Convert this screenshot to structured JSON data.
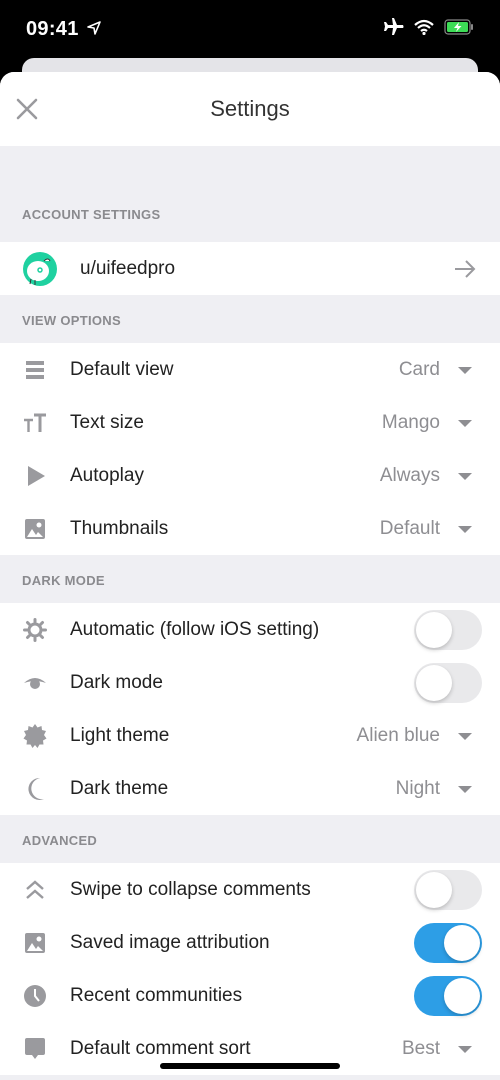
{
  "status_bar": {
    "time": "09:41",
    "icons": [
      "location-arrow-icon",
      "airplane-icon",
      "wifi-icon",
      "battery-charging-icon"
    ]
  },
  "header": {
    "title": "Settings",
    "close_icon": "close-icon"
  },
  "colors": {
    "accent": "#2d9ee6",
    "avatar": "#1fd1a0",
    "background": "#efeff3",
    "secondary_text": "#8e8e92"
  },
  "sections": {
    "account": {
      "heading": "ACCOUNT SETTINGS",
      "username": "u/uifeedpro"
    },
    "view_options": {
      "heading": "VIEW OPTIONS",
      "items": [
        {
          "label": "Default view",
          "value": "Card",
          "icon": "list-icon"
        },
        {
          "label": "Text size",
          "value": "Mango",
          "icon": "text-size-icon"
        },
        {
          "label": "Autoplay",
          "value": "Always",
          "icon": "play-icon"
        },
        {
          "label": "Thumbnails",
          "value": "Default",
          "icon": "image-icon"
        }
      ]
    },
    "dark_mode": {
      "heading": "DARK MODE",
      "items": [
        {
          "label": "Automatic (follow iOS setting)",
          "toggle": false,
          "icon": "sun-icon"
        },
        {
          "label": "Dark mode",
          "toggle": false,
          "icon": "eye-icon"
        },
        {
          "label": "Light theme",
          "value": "Alien blue",
          "icon": "badge-icon"
        },
        {
          "label": "Dark theme",
          "value": "Night",
          "icon": "moon-icon"
        }
      ]
    },
    "advanced": {
      "heading": "ADVANCED",
      "items": [
        {
          "label": "Swipe to collapse comments",
          "toggle": false,
          "icon": "double-chevron-up-icon"
        },
        {
          "label": "Saved image attribution",
          "toggle": true,
          "icon": "image-icon"
        },
        {
          "label": "Recent communities",
          "toggle": true,
          "icon": "clock-icon"
        },
        {
          "label": "Default comment sort",
          "value": "Best",
          "icon": "comment-icon"
        }
      ]
    }
  }
}
